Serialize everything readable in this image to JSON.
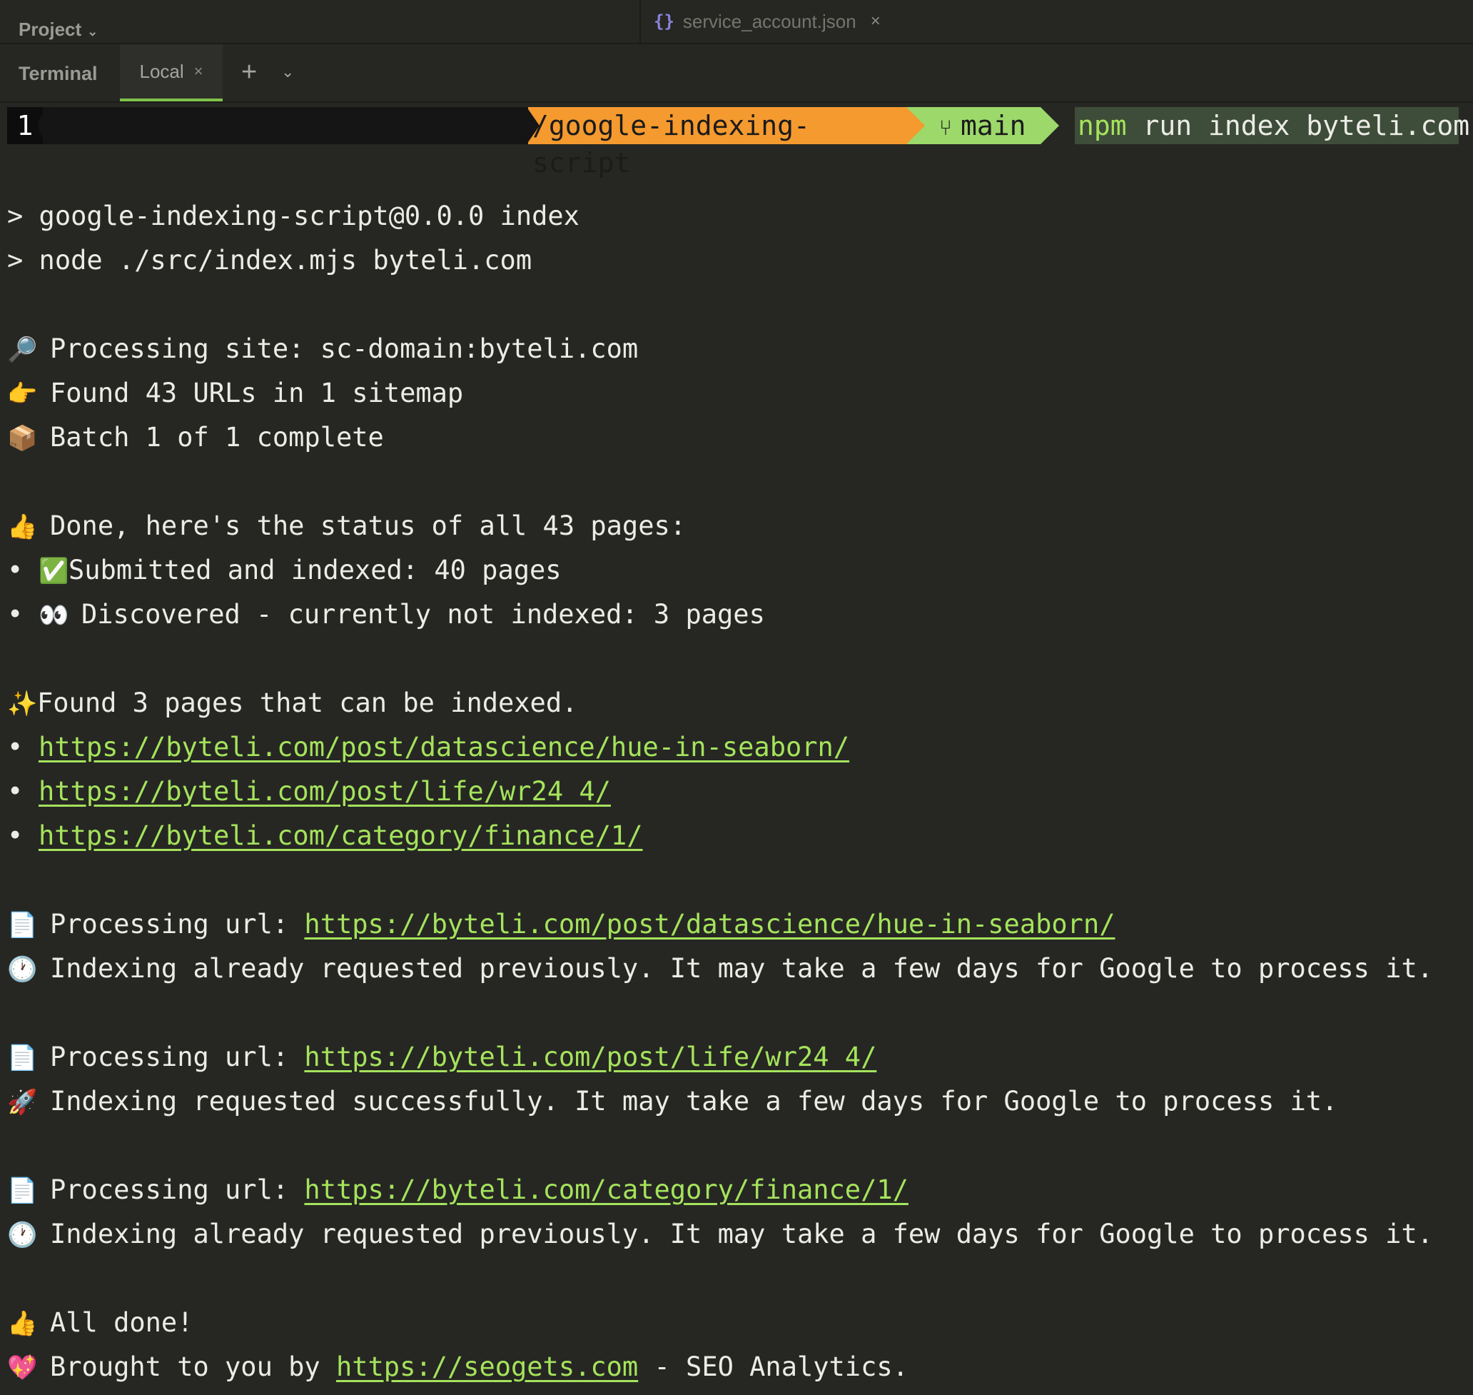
{
  "topbar": {
    "project_label": "Project",
    "file_tab": {
      "icon": "{}",
      "name": "service_account.json"
    }
  },
  "tabbar": {
    "terminal_label": "Terminal",
    "local_tab": "Local",
    "add_icon": "+",
    "dropdown_icon": "⌄"
  },
  "prompt": {
    "number": "1",
    "path": "/google-indexing-script",
    "branch": "main",
    "cmd_npm": "npm",
    "cmd_rest": " run index byteli.com"
  },
  "output": {
    "script_line1": "> google-indexing-script@0.0.0 index",
    "script_line2": "> node ./src/index.mjs byteli.com",
    "processing_site": "Processing site: sc-domain:byteli.com",
    "found_urls": "Found 43 URLs in 1 sitemap",
    "batch": "Batch 1 of 1 complete",
    "done_status": "Done, here's the status of all 43 pages:",
    "status_submitted": "Submitted and indexed: 40 pages",
    "status_discovered": "Discovered - currently not indexed: 3 pages",
    "found_indexable": "Found 3 pages that can be indexed.",
    "urls": [
      "https://byteli.com/post/datascience/hue-in-seaborn/",
      "https://byteli.com/post/life/wr24_4/",
      "https://byteli.com/category/finance/1/"
    ],
    "processing_url_label": "Processing url: ",
    "msg_already": "Indexing already requested previously. It may take a few days for Google to process it.",
    "msg_success": "Indexing requested successfully. It may take a few days for Google to process it.",
    "all_done": "All done!",
    "brought_prefix": "Brought to you by ",
    "brought_link": "https://seogets.com",
    "brought_suffix": " - SEO Analytics.",
    "bullet": "•"
  },
  "icons": {
    "magnifier": "🔎",
    "pointing": "👉",
    "package": "📦",
    "thumbs_up": "👍",
    "check": "✅",
    "eyes": "👀",
    "sparkles": "✨",
    "page": "📄",
    "clock": "🕐",
    "rocket": "🚀",
    "heart": "💖"
  },
  "colors": {
    "background": "#262723",
    "link": "#a5e35c",
    "path_segment": "#f59a2f",
    "branch_segment": "#9cd86a",
    "active_tab_underline": "#7fc24a"
  }
}
